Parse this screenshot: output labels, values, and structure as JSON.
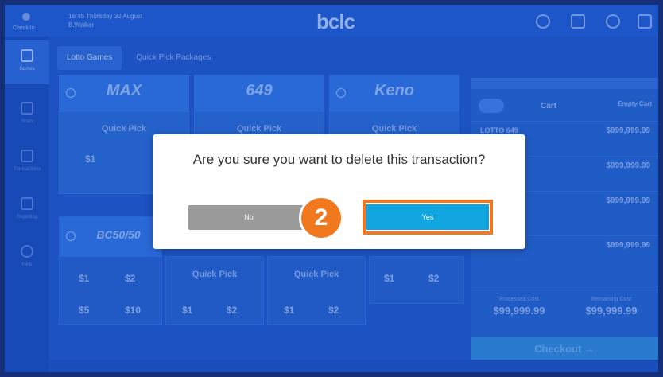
{
  "header": {
    "store_label": "Check In",
    "datetime_line1": "16:45 Thursday 30 August",
    "datetime_line2": "B.Walker",
    "logo": "bclc"
  },
  "sidebar": {
    "items": [
      {
        "label": "Games"
      },
      {
        "label": "Scan"
      },
      {
        "label": "Transactions"
      },
      {
        "label": "Reporting"
      },
      {
        "label": "Help"
      }
    ]
  },
  "tabs": [
    {
      "label": "Lotto Games"
    },
    {
      "label": "Quick Pick Packages"
    }
  ],
  "games": {
    "max": {
      "name": "MAX",
      "quick_pick": "Quick Pick",
      "price": "$1"
    },
    "six49": {
      "name": "649",
      "quick_pick": "Quick Pick",
      "price": "$"
    },
    "keno": {
      "name": "Keno",
      "quick_pick": "Quick Pick"
    },
    "bc50": {
      "name": "BC50/50",
      "prices": [
        "$1",
        "$2",
        "$5",
        "$10"
      ]
    },
    "row2_tile2": {
      "quick_pick": "Quick Pick",
      "prices": [
        "$1",
        "$2"
      ]
    },
    "row2_tile3": {
      "quick_pick": "Quick Pick",
      "prices": [
        "$1",
        "$2"
      ]
    },
    "row2_tile4": {
      "prices": [
        "$1",
        "$2"
      ]
    }
  },
  "cart": {
    "title": "Cart",
    "empty_button": "Empty Cart",
    "lines": [
      {
        "name": "LOTTO 649",
        "amount": "$999,999.99"
      },
      {
        "name": "",
        "amount": "$999,999.99"
      },
      {
        "name": "",
        "amount": "$999,999.99"
      },
      {
        "name": "",
        "amount": "$999,999.99"
      }
    ],
    "processed_label": "Processed Cost",
    "processed_value": "$99,999.99",
    "remaining_label": "Remaining Cost",
    "remaining_value": "$99,999.99",
    "checkout": "Checkout →"
  },
  "modal": {
    "message": "Are you sure you want to delete this transaction?",
    "no_label": "No",
    "yes_label": "Yes",
    "step": "2"
  },
  "colors": {
    "accent_orange": "#f0781e",
    "yes_blue": "#11a6e0",
    "no_gray": "#9a9a9a"
  }
}
